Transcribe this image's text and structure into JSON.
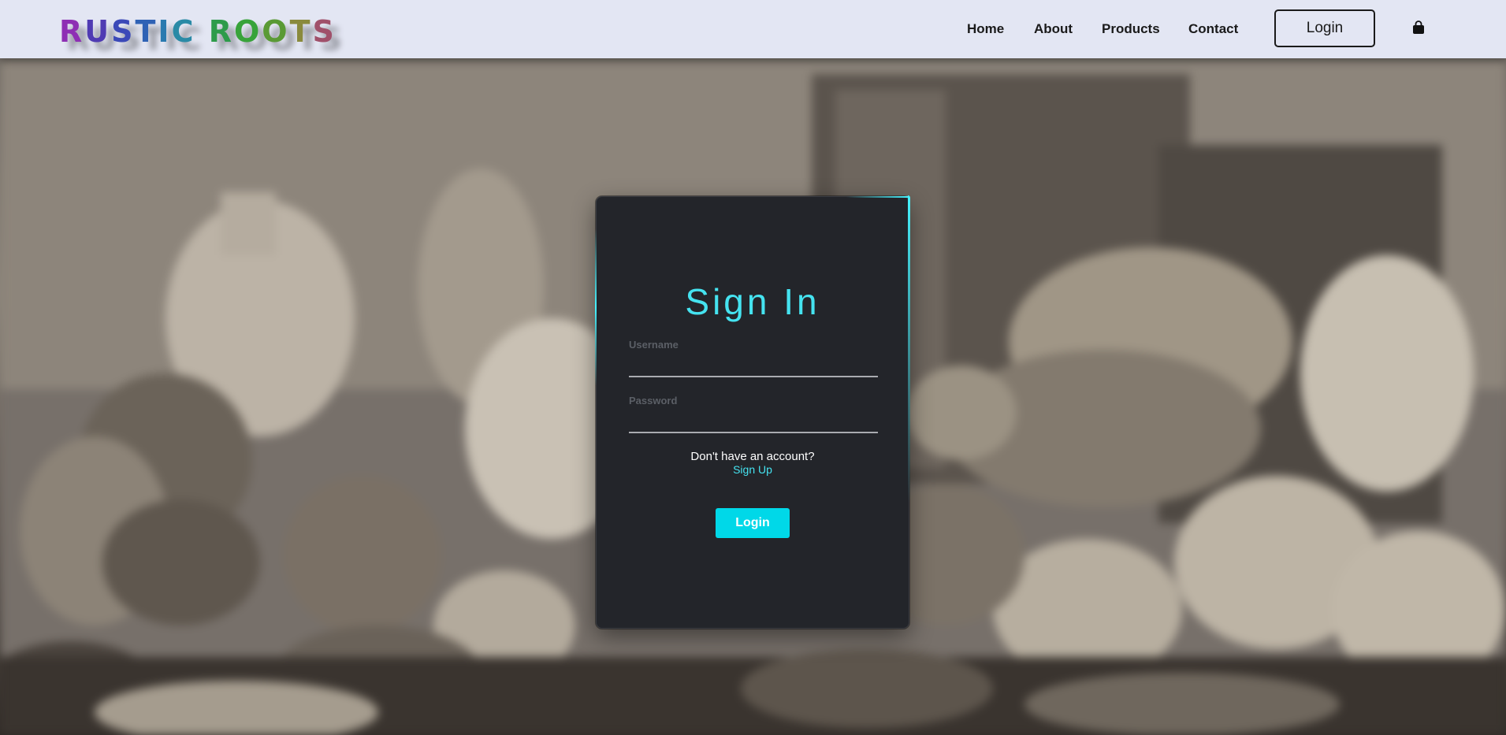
{
  "brand": {
    "logo_letters": [
      {
        "ch": "R",
        "color": "#8e2fb4"
      },
      {
        "ch": "U",
        "color": "#4f3bb3"
      },
      {
        "ch": "S",
        "color": "#3b49b8"
      },
      {
        "ch": "T",
        "color": "#2f62b5"
      },
      {
        "ch": "I",
        "color": "#2a7ab0"
      },
      {
        "ch": "C",
        "color": "#2a8aa6"
      },
      {
        "ch": " ",
        "color": "#000000"
      },
      {
        "ch": "R",
        "color": "#2d9b4a"
      },
      {
        "ch": "O",
        "color": "#38a33a"
      },
      {
        "ch": "O",
        "color": "#5a9a35"
      },
      {
        "ch": "T",
        "color": "#8a8a3c"
      },
      {
        "ch": "S",
        "color": "#a0506a"
      }
    ]
  },
  "nav": {
    "items": [
      {
        "label": "Home"
      },
      {
        "label": "About"
      },
      {
        "label": "Products"
      },
      {
        "label": "Contact"
      }
    ],
    "login_label": "Login",
    "cart_icon": "shopping-bag-icon"
  },
  "signin": {
    "title": "Sign In",
    "username_label": "Username",
    "password_label": "Password",
    "no_account_text": "Don't have an account?",
    "signup_link": "Sign Up",
    "login_button": "Login"
  },
  "colors": {
    "accent": "#45e3f0",
    "button": "#00d8e8",
    "card": "#23252a",
    "header": "#e3e6f3"
  }
}
